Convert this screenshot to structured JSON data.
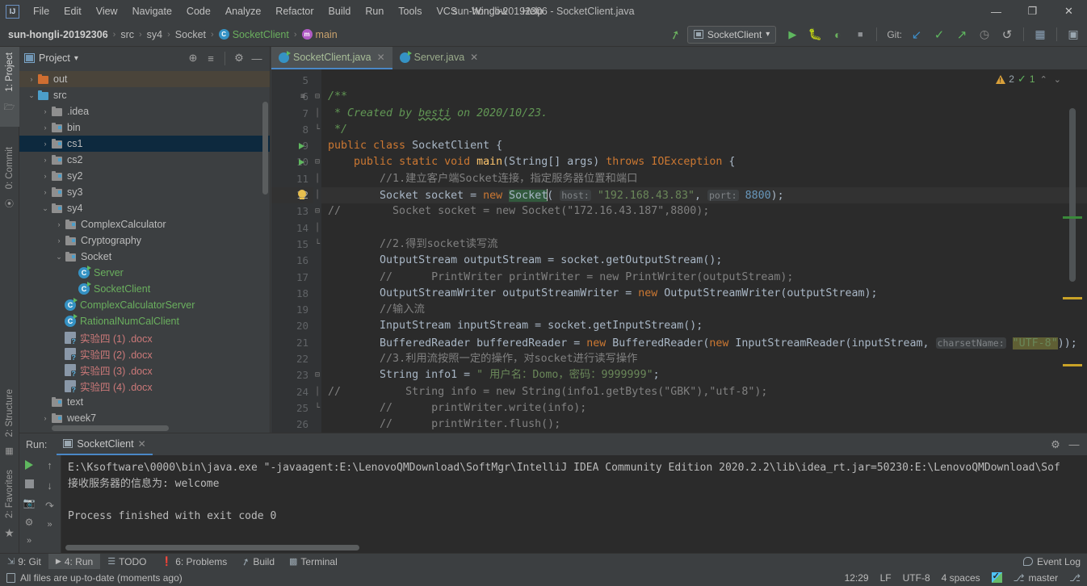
{
  "window": {
    "title": "sun-hongli-20192306 - SocketClient.java",
    "logo": "IJ",
    "minimize": "—",
    "maximize": "❐",
    "close": "✕"
  },
  "menubar": {
    "items": [
      {
        "label": "File"
      },
      {
        "label": "Edit"
      },
      {
        "label": "View"
      },
      {
        "label": "Navigate"
      },
      {
        "label": "Code"
      },
      {
        "label": "Analyze"
      },
      {
        "label": "Refactor"
      },
      {
        "label": "Build"
      },
      {
        "label": "Run"
      },
      {
        "label": "Tools"
      },
      {
        "label": "VCS"
      },
      {
        "label": "Window"
      },
      {
        "label": "Help"
      }
    ]
  },
  "breadcrumb": {
    "items": [
      {
        "label": "sun-hongli-20192306"
      },
      {
        "label": "src"
      },
      {
        "label": "sy4"
      },
      {
        "label": "Socket"
      },
      {
        "label": "SocketClient"
      },
      {
        "label": "main"
      }
    ],
    "separator": "›"
  },
  "toolbar": {
    "build_icon": "hammer-icon",
    "run_config": "SocketClient",
    "dropdown_caret": "▾",
    "run_icon": "▶",
    "debug_icon": "debug-bug-icon",
    "coverage_icon": "run-with-coverage-icon",
    "stop_icon": "■",
    "git_label": "Git:",
    "git_update_icon": "↙",
    "git_commit_icon": "✓",
    "git_push_icon": "↗",
    "git_history_icon": "◷",
    "git_rollback_icon": "↺",
    "search_everywhere_icon": "project-structure-icon",
    "settings_icon": "run-window-icon"
  },
  "left_strip": {
    "project_tab": "1: Project",
    "commit_tab": "0: Commit",
    "structure_tab": "2: Structure",
    "favorites_tab": "2: Favorites"
  },
  "project_panel": {
    "title": "Project",
    "caret": "▾",
    "locate_icon": "⊕",
    "collapse_icon": "≡",
    "settings_icon": "⚙",
    "hide_icon": "—",
    "tree": [
      {
        "label": "out",
        "depth": 1,
        "arrow": "›",
        "icon": "folder-orange",
        "state": "hover"
      },
      {
        "label": "src",
        "depth": 1,
        "arrow": "⌄",
        "icon": "folder-blue",
        "state": "normal"
      },
      {
        "label": ".idea",
        "depth": 2,
        "arrow": "›",
        "icon": "folder-gray",
        "state": "normal"
      },
      {
        "label": "bin",
        "depth": 2,
        "arrow": "›",
        "icon": "folder-src",
        "state": "normal"
      },
      {
        "label": "cs1",
        "depth": 2,
        "arrow": "›",
        "icon": "folder-src",
        "state": "selected"
      },
      {
        "label": "cs2",
        "depth": 2,
        "arrow": "›",
        "icon": "folder-src",
        "state": "normal"
      },
      {
        "label": "sy2",
        "depth": 2,
        "arrow": "›",
        "icon": "folder-src",
        "state": "normal"
      },
      {
        "label": "sy3",
        "depth": 2,
        "arrow": "›",
        "icon": "folder-src",
        "state": "normal"
      },
      {
        "label": "sy4",
        "depth": 2,
        "arrow": "⌄",
        "icon": "folder-src",
        "state": "normal"
      },
      {
        "label": "ComplexCalculator",
        "depth": 3,
        "arrow": "›",
        "icon": "folder-src",
        "state": "normal"
      },
      {
        "label": "Cryptography",
        "depth": 3,
        "arrow": "›",
        "icon": "folder-src",
        "state": "normal"
      },
      {
        "label": "Socket",
        "depth": 3,
        "arrow": "⌄",
        "icon": "folder-src",
        "state": "normal"
      },
      {
        "label": "Server",
        "depth": 4,
        "arrow": "",
        "icon": "class",
        "style": "green"
      },
      {
        "label": "SocketClient",
        "depth": 4,
        "arrow": "",
        "icon": "class",
        "style": "green"
      },
      {
        "label": "ComplexCalculatorServer",
        "depth": 3,
        "arrow": "",
        "icon": "class",
        "style": "green"
      },
      {
        "label": "RationalNumCalClient",
        "depth": 3,
        "arrow": "",
        "icon": "class",
        "style": "green"
      },
      {
        "label": "实验四 (1) .docx",
        "depth": 3,
        "arrow": "",
        "icon": "doc",
        "style": "red"
      },
      {
        "label": "实验四 (2) .docx",
        "depth": 3,
        "arrow": "",
        "icon": "doc",
        "style": "red"
      },
      {
        "label": "实验四 (3) .docx",
        "depth": 3,
        "arrow": "",
        "icon": "doc",
        "style": "red"
      },
      {
        "label": "实验四 (4) .docx",
        "depth": 3,
        "arrow": "",
        "icon": "doc",
        "style": "red"
      },
      {
        "label": "text",
        "depth": 2,
        "arrow": "",
        "icon": "folder-src",
        "state": "normal"
      },
      {
        "label": "week7",
        "depth": 2,
        "arrow": "›",
        "icon": "folder-src",
        "state": "normal"
      }
    ]
  },
  "editor": {
    "tabs": [
      {
        "label": "SocketClient.java",
        "active": true,
        "close": "✕"
      },
      {
        "label": "Server.java",
        "active": false,
        "close": "✕"
      }
    ],
    "inspections": {
      "warning_count": "2",
      "ok_count": "1",
      "up_caret": "⌃",
      "down_caret": "⌄"
    },
    "lines": [
      {
        "n": "5",
        "text": ""
      },
      {
        "n": "6",
        "text": "/**"
      },
      {
        "n": "7",
        "text": "  * Created by besti on 2020/10/23."
      },
      {
        "n": "8",
        "text": "  */"
      },
      {
        "n": "9",
        "text": "public class SocketClient {"
      },
      {
        "n": "10",
        "text": "    public static void main(String[] args) throws IOException {"
      },
      {
        "n": "11",
        "text": "        //1.建立客户端Socket连接，指定服务器位置和端口"
      },
      {
        "n": "12",
        "text": "        Socket socket = new Socket( host: \"192.168.43.83\", port: 8800);"
      },
      {
        "n": "13",
        "text": "//        Socket socket = new Socket(\"172.16.43.187\",8800);"
      },
      {
        "n": "14",
        "text": ""
      },
      {
        "n": "15",
        "text": "        //2.得到socket读写流"
      },
      {
        "n": "16",
        "text": "        OutputStream outputStream = socket.getOutputStream();"
      },
      {
        "n": "17",
        "text": "        //      PrintWriter printWriter = new PrintWriter(outputStream);"
      },
      {
        "n": "18",
        "text": "        OutputStreamWriter outputStreamWriter = new OutputStreamWriter(outputStream);"
      },
      {
        "n": "19",
        "text": "        //输入流"
      },
      {
        "n": "20",
        "text": "        InputStream inputStream = socket.getInputStream();"
      },
      {
        "n": "21",
        "text": "        BufferedReader bufferedReader = new BufferedReader(new InputStreamReader(inputStream, charsetName: \"UTF-8\"));"
      },
      {
        "n": "22",
        "text": "        //3.利用流按照一定的操作，对socket进行读写操作"
      },
      {
        "n": "23",
        "text": "        String info1 = \" 用户名：Domo，密码：9999999\";"
      },
      {
        "n": "24",
        "text": "//          String info = new String(info1.getBytes(\"GBK\"),\"utf-8\");"
      },
      {
        "n": "25",
        "text": "        //      printWriter.write(info);"
      },
      {
        "n": "26",
        "text": "        //      printWriter.flush();"
      }
    ]
  },
  "run_panel": {
    "label": "Run:",
    "tab": "SocketClient",
    "close": "✕",
    "settings_icon": "⚙",
    "hide_icon": "—",
    "tools": {
      "rerun_icon": "▶",
      "stop_icon": "■",
      "dump_icon": "camera-icon",
      "thread_icon": "thread-dump-icon",
      "more_icon": "»",
      "up_icon": "↑",
      "down_icon": "↓",
      "soft_wrap_icon": "soft-wrap-icon",
      "more2_icon": "»"
    },
    "console": [
      "E:\\Ksoftware\\0000\\bin\\java.exe \"-javaagent:E:\\LenovoQMDownload\\SoftMgr\\IntelliJ IDEA Community Edition 2020.2.2\\lib\\idea_rt.jar=50230:E:\\LenovoQMDownload\\Sof",
      "接收服务器的信息为: welcome",
      "",
      "Process finished with exit code 0"
    ]
  },
  "bottom_bar": {
    "items": [
      {
        "label": "9: Git",
        "icon": "git-icon",
        "active": false
      },
      {
        "label": "4: Run",
        "icon": "run-icon",
        "active": true
      },
      {
        "label": "TODO",
        "icon": "todo-icon",
        "active": false
      },
      {
        "label": "6: Problems",
        "icon": "problems-icon",
        "active": false
      },
      {
        "label": "Build",
        "icon": "build-hammer-icon",
        "active": false
      },
      {
        "label": "Terminal",
        "icon": "terminal-icon",
        "active": false
      }
    ],
    "event_log": "Event Log"
  },
  "status_bar": {
    "message": "All files are up-to-date (moments ago)",
    "position": "12:29",
    "line_separator": "LF",
    "encoding": "UTF-8",
    "indent": "4 spaces",
    "branch": "master",
    "vcs_icon": "vcs-check-icon",
    "branch_icon": "⎇",
    "lock_icon": "⎇"
  },
  "colors": {
    "accent": "#4a88c7",
    "panel_bg": "#3c3f41",
    "editor_bg": "#2b2b2b",
    "selection": "#0d293e",
    "keyword": "#cc7832",
    "string": "#6a8759",
    "comment": "#808080",
    "javadoc": "#629755",
    "number": "#6897bb",
    "green": "#6aaf5e",
    "warning": "#d9a03a"
  }
}
